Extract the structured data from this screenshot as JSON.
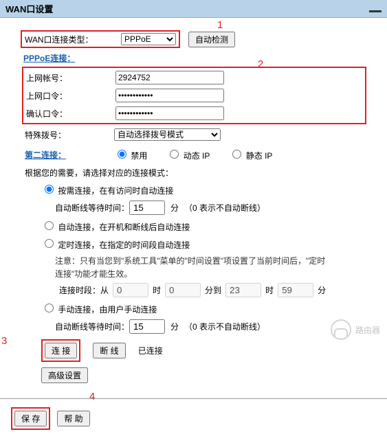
{
  "title": "WAN口设置",
  "wan": {
    "label": "WAN口连接类型：",
    "value": "PPPoE",
    "auto_detect": "自动检测"
  },
  "pppoe_section": "PPPoE连接：",
  "account": {
    "label": "上网帐号：",
    "value": "2924752"
  },
  "password": {
    "label": "上网口令：",
    "value": "••••••••••••"
  },
  "confirm": {
    "label": "确认口令：",
    "value": "••••••••••••"
  },
  "special_dial": {
    "label": "特殊拨号：",
    "value": "自动选择拨号模式"
  },
  "second_conn": {
    "label": "第二连接：",
    "opts": [
      "禁用",
      "动态 IP",
      "静态 IP"
    ],
    "selected": 0
  },
  "mode_hint": "根据您的需要，请选择对应的连接模式：",
  "modes": [
    "按需连接，在有访问时自动连接",
    "自动连接，在开机和断线后自动连接",
    "定时连接，在指定的时间段自动连接",
    "手动连接，由用户手动连接"
  ],
  "selected_mode": 0,
  "auto_disc": {
    "label": "自动断线等待时间：",
    "value": "15",
    "unit": "分",
    "hint": "（0 表示不自动断线）"
  },
  "timed_note": "注意：只有当您到\"系统工具\"菜单的\"时间设置\"项设置了当前时间后，\"定时连接\"功能才能生效。",
  "time_period": {
    "label": "连接时段：从",
    "h1": "0",
    "m1": "0",
    "h2": "23",
    "m2": "59",
    "hour": "时",
    "min": "分",
    "to": "分到"
  },
  "connect_btn": "连 接",
  "disconnect_btn": "断 线",
  "status": "已连接",
  "advanced": "高级设置",
  "save": "保 存",
  "help": "帮 助",
  "annot": {
    "a1": "1",
    "a2": "2",
    "a3": "3",
    "a4": "4"
  },
  "watermark": "路由器"
}
